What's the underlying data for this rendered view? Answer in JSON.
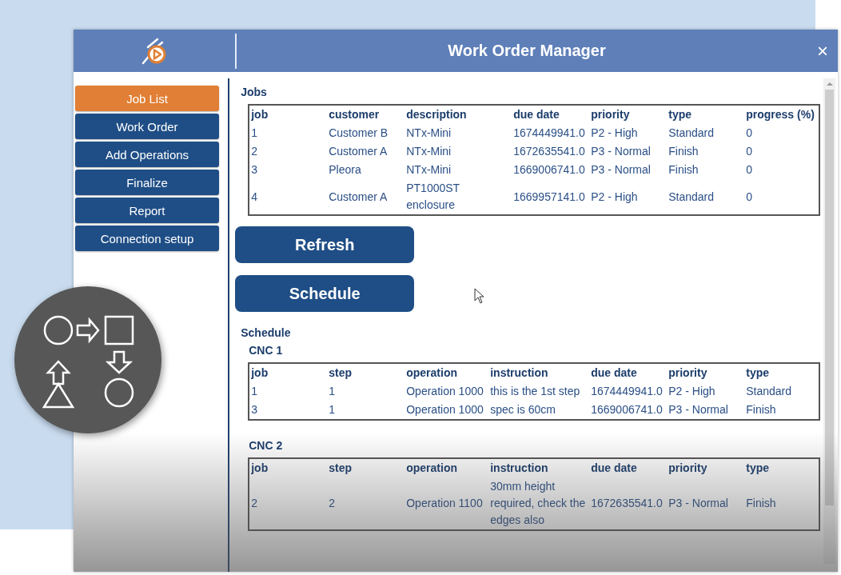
{
  "window": {
    "title": "Work Order Manager",
    "close": "×"
  },
  "sidebar": {
    "items": [
      {
        "label": "Job List",
        "selected": true
      },
      {
        "label": "Work Order",
        "selected": false
      },
      {
        "label": "Add Operations",
        "selected": false
      },
      {
        "label": "Finalize",
        "selected": false
      },
      {
        "label": "Report",
        "selected": false
      },
      {
        "label": "Connection setup",
        "selected": false
      }
    ]
  },
  "jobs": {
    "title": "Jobs",
    "columns": [
      "job",
      "customer",
      "description",
      "due date",
      "priority",
      "type",
      "progress (%)"
    ],
    "rows": [
      [
        "1",
        "Customer B",
        "NTx-Mini",
        "1674449941.0",
        "P2 - High",
        "Standard",
        "0"
      ],
      [
        "2",
        "Customer A",
        "NTx-Mini",
        "1672635541.0",
        "P3 - Normal",
        "Finish",
        "0"
      ],
      [
        "3",
        "Pleora",
        "NTx-Mini",
        "1669006741.0",
        "P3 - Normal",
        "Finish",
        "0"
      ],
      [
        "4",
        "Customer A",
        "PT1000ST enclosure",
        "1669957141.0",
        "P2 - High",
        "Standard",
        "0"
      ]
    ]
  },
  "buttons": [
    "Refresh",
    "Schedule"
  ],
  "schedule": {
    "title": "Schedule",
    "machines": [
      {
        "name": "CNC 1",
        "columns": [
          "job",
          "step",
          "operation",
          "instruction",
          "due date",
          "priority",
          "type"
        ],
        "rows": [
          [
            "1",
            "1",
            "Operation 1000",
            "this is the 1st step",
            "1674449941.0",
            "P2 - High",
            "Standard"
          ],
          [
            "3",
            "1",
            "Operation 1000",
            "spec is 60cm",
            "1669006741.0",
            "P3 - Normal",
            "Finish"
          ]
        ]
      },
      {
        "name": "CNC 2",
        "columns": [
          "job",
          "step",
          "operation",
          "instruction",
          "due date",
          "priority",
          "type"
        ],
        "rows": [
          [
            "2",
            "2",
            "Operation 1100",
            "30mm height required, check the edges also",
            "1672635541.0",
            "P3 - Normal",
            "Finish"
          ]
        ]
      }
    ]
  }
}
